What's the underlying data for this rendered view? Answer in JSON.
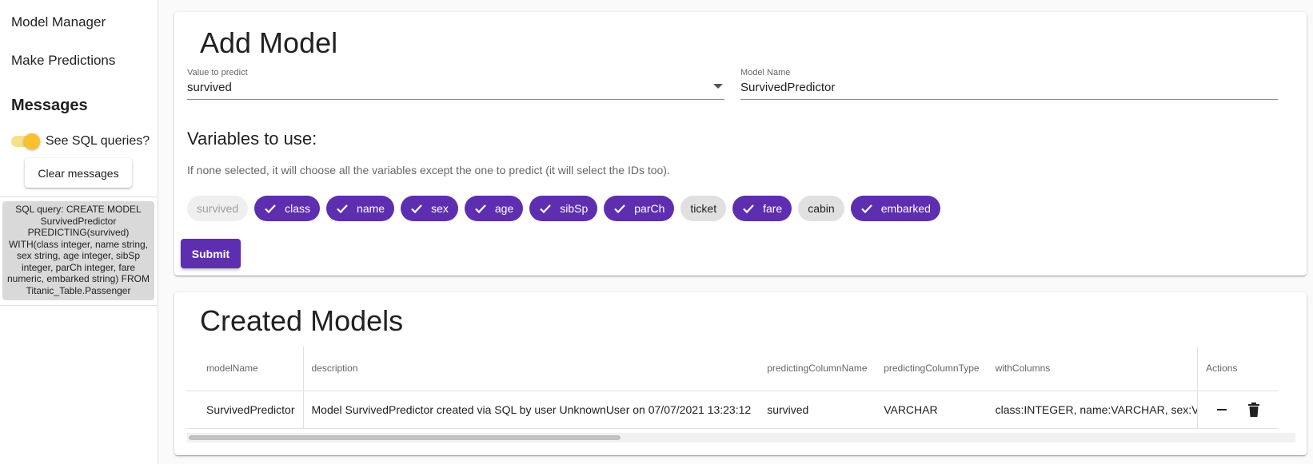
{
  "sidebar": {
    "nav": [
      {
        "label": "Model Manager"
      },
      {
        "label": "Make Predictions"
      }
    ],
    "messages_heading": "Messages",
    "toggle_label": "See SQL queries?",
    "toggle_on": true,
    "clear_button": "Clear messages",
    "sql_message": "SQL query: CREATE MODEL SurvivedPredictor PREDICTING(survived) WITH(class integer, name string, sex string, age integer, sibSp integer, parCh integer, fare numeric, embarked string) FROM Titanic_Table.Passenger"
  },
  "add_model": {
    "title": "Add Model",
    "predict": {
      "label": "Value to predict",
      "value": "survived"
    },
    "model_name": {
      "label": "Model Name",
      "value": "SurvivedPredictor"
    },
    "vars_heading": "Variables to use:",
    "vars_hint": "If none selected, it will choose all the variables except the one to predict (it will select the IDs too).",
    "chips": [
      {
        "label": "survived",
        "state": "disabled"
      },
      {
        "label": "class",
        "state": "selected"
      },
      {
        "label": "name",
        "state": "selected"
      },
      {
        "label": "sex",
        "state": "selected"
      },
      {
        "label": "age",
        "state": "selected"
      },
      {
        "label": "sibSp",
        "state": "selected"
      },
      {
        "label": "parCh",
        "state": "selected"
      },
      {
        "label": "ticket",
        "state": "unselected"
      },
      {
        "label": "fare",
        "state": "selected"
      },
      {
        "label": "cabin",
        "state": "unselected"
      },
      {
        "label": "embarked",
        "state": "selected"
      }
    ],
    "submit_label": "Submit"
  },
  "created_models": {
    "title": "Created Models",
    "columns": [
      "modelName",
      "description",
      "predictingColumnName",
      "predictingColumnType",
      "withColumns",
      "Actions"
    ],
    "rows": [
      {
        "modelName": "SurvivedPredictor",
        "description": "Model SurvivedPredictor created via SQL by user UnknownUser on 07/07/2021 13:23:12",
        "predictingColumnName": "survived",
        "predictingColumnType": "VARCHAR",
        "withColumns": "class:INTEGER, name:VARCHAR, sex:VA"
      }
    ]
  },
  "colors": {
    "primary": "#5e2eb0",
    "toggle_accent": "#fbc02d"
  }
}
